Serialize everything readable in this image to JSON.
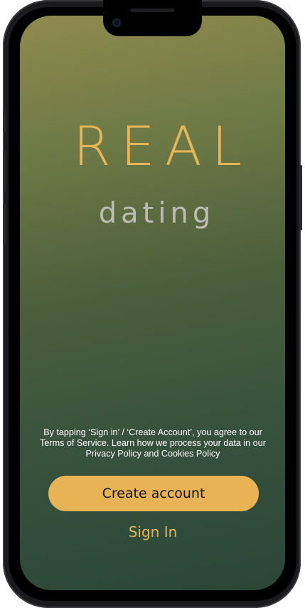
{
  "app": {
    "logo_main": "REAL",
    "logo_sub": "dating"
  },
  "legal": {
    "line1": "By tapping ‘Sign in’ / ‘Create Account’, you agree to our",
    "line2": "Terms of Service. Learn how we process your data in our",
    "line3": "Privacy Policy and Cookies Policy"
  },
  "actions": {
    "create_account_label": "Create account",
    "sign_in_label": "Sign In"
  },
  "colors": {
    "accent": "#e7b354",
    "subtitle": "#bdbdb4",
    "gradient_top": "#8f8a4e",
    "gradient_bottom": "#2a4637"
  }
}
